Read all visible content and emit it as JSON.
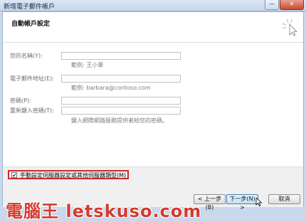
{
  "window": {
    "title": "新增電子郵件帳戶",
    "min_label": "—",
    "close_label": "✕"
  },
  "header": {
    "title": "自動帳戶設定"
  },
  "form": {
    "name_label": "您的名稱(Y):",
    "name_value": "",
    "name_hint": "範例: 王小華",
    "email_label": "電子郵件地址(E):",
    "email_value": "",
    "email_hint": "範例: barbara@contoso.com",
    "password_label": "密碼(P):",
    "password_value": "",
    "confirm_label": "重新鍵入密碼(T):",
    "confirm_value": "",
    "password_hint": "鍵入網際網路服務提供者給您的密碼。"
  },
  "manual_setup": {
    "checked": true,
    "label": "手動設定伺服器設定或其他伺服器類型(M)"
  },
  "buttons": {
    "back": "< 上一步(B)",
    "next": "下一步(N) >",
    "cancel": "取消"
  },
  "watermark": {
    "text": "電腦王 letskuso.com"
  },
  "colors": {
    "highlight_border": "#cc2a2a",
    "watermark": "#d43a2f"
  }
}
